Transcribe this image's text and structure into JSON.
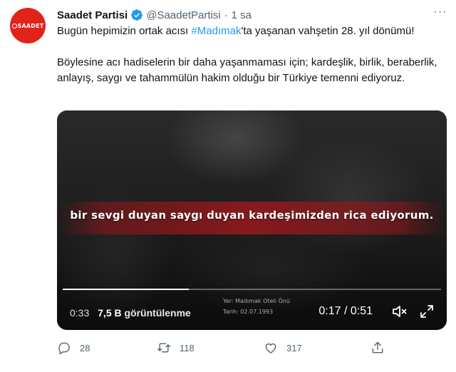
{
  "account": {
    "display_name": "Saadet Partisi",
    "handle": "@SaadetPartisi",
    "time": "1 sa",
    "avatar_text": "SAADET"
  },
  "tweet": {
    "line1_before": "Bugün hepimizin ortak acısı ",
    "hashtag": "#Madımak",
    "line1_after": "'ta yaşanan vahşetin 28. yıl dönümü!",
    "paragraph2": "Böylesine acı hadiselerin bir daha yaşanmaması için; kardeşlik, birlik, beraberlik, anlayış, saygı ve tahammülün hakim olduğu bir Türkiye temenni ediyoruz."
  },
  "video": {
    "subtitle": "bir sevgi duyan saygı duyan kardeşimizden rica ediyorum.",
    "location_line1": "Yer: Madımak Oteli Önü",
    "location_line2": "Tarih: 02.07.1993",
    "time_badge": "0:33",
    "views_count": "7,5 B",
    "views_label": "görüntülenme",
    "duration": "0:17 / 0:51",
    "progress_fraction": 0.333
  },
  "actions": {
    "reply_count": "28",
    "retweet_count": "118",
    "like_count": "317"
  },
  "colors": {
    "accent": "#1d9bf0",
    "avatar_red": "#e2231a",
    "muted": "#536471"
  },
  "icons": [
    "verified-icon",
    "more-icon",
    "mute-icon",
    "fullscreen-icon",
    "reply-icon",
    "retweet-icon",
    "like-icon",
    "share-icon"
  ]
}
